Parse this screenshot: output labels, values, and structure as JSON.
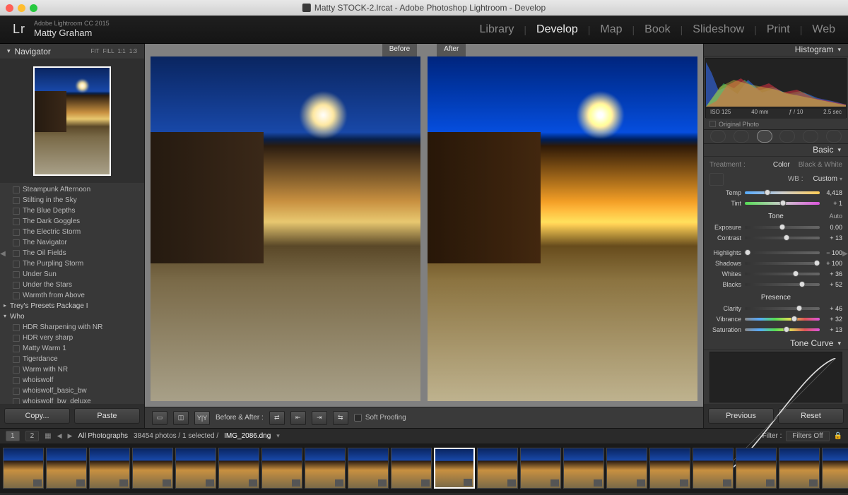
{
  "mac": {
    "title": "Matty STOCK-2.lrcat - Adobe Photoshop Lightroom - Develop"
  },
  "identity": {
    "product": "Adobe Lightroom CC 2015",
    "user": "Matty Graham"
  },
  "modules": [
    "Library",
    "Develop",
    "Map",
    "Book",
    "Slideshow",
    "Print",
    "Web"
  ],
  "active_module": "Develop",
  "navigator": {
    "title": "Navigator",
    "zoom": [
      "FIT",
      "FILL",
      "1:1",
      "1:3"
    ]
  },
  "presets": {
    "items": [
      "Steampunk Afternoon",
      "Stilting in the Sky",
      "The Blue Depths",
      "The Dark Goggles",
      "The Electric Storm",
      "The Navigator",
      "The Oil Fields",
      "The Purpling Storm",
      "Under Sun",
      "Under the Stars",
      "Warmth from Above"
    ],
    "folders": [
      {
        "name": "Trey's Presets Package I",
        "open": false
      },
      {
        "name": "Who",
        "open": true,
        "items": [
          "HDR Sharpening with NR",
          "HDR very sharp",
          "Matty Warm 1",
          "Tigerdance",
          "Warm with NR",
          "whoiswolf",
          "whoiswolf_basic_bw",
          "whoiswolf_bw_deluxe"
        ]
      }
    ]
  },
  "left_buttons": {
    "copy": "Copy...",
    "paste": "Paste"
  },
  "before_after": {
    "before": "Before",
    "after": "After",
    "toolbar_label": "Before & After :",
    "soft_proof": "Soft Proofing"
  },
  "histogram": {
    "title": "Histogram",
    "iso": "ISO 125",
    "focal": "40 mm",
    "aperture": "ƒ / 10",
    "shutter": "2.5 sec",
    "original": "Original Photo"
  },
  "basic": {
    "title": "Basic",
    "treatment_label": "Treatment :",
    "color": "Color",
    "bw": "Black & White",
    "wb_label": "WB :",
    "wb_value": "Custom",
    "temp_label": "Temp",
    "temp_value": "4,418",
    "tint_label": "Tint",
    "tint_value": "+ 1",
    "tone_title": "Tone",
    "auto": "Auto",
    "exposure_label": "Exposure",
    "exposure_value": "0.00",
    "contrast_label": "Contrast",
    "contrast_value": "+ 13",
    "highlights_label": "Highlights",
    "highlights_value": "− 100",
    "shadows_label": "Shadows",
    "shadows_value": "+ 100",
    "whites_label": "Whites",
    "whites_value": "+ 36",
    "blacks_label": "Blacks",
    "blacks_value": "+ 52",
    "presence_title": "Presence",
    "clarity_label": "Clarity",
    "clarity_value": "+ 46",
    "vibrance_label": "Vibrance",
    "vibrance_value": "+ 32",
    "saturation_label": "Saturation",
    "saturation_value": "+ 13"
  },
  "tone_curve": {
    "title": "Tone Curve"
  },
  "right_buttons": {
    "previous": "Previous",
    "reset": "Reset"
  },
  "filmstrip": {
    "pages": [
      "1",
      "2"
    ],
    "path": "All Photographs",
    "count": "38454 photos / 1 selected /",
    "filename": "IMG_2086.dng",
    "filter_label": "Filter :",
    "filter_value": "Filters Off",
    "selected_index": 10,
    "thumb_count": 20
  }
}
